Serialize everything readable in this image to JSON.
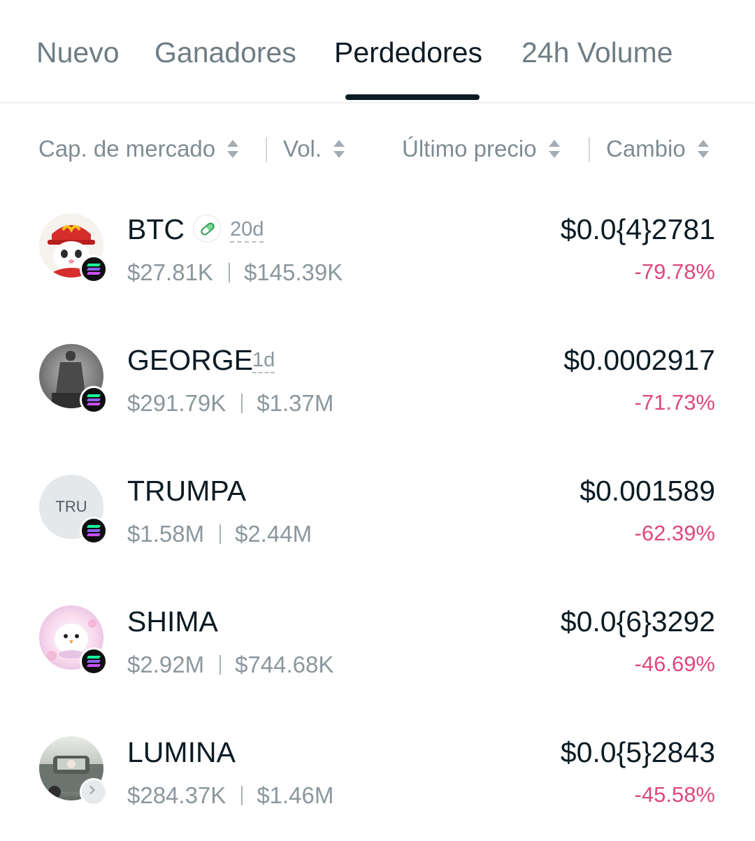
{
  "tabs": [
    {
      "label": "Nuevo",
      "active": false
    },
    {
      "label": "Ganadores",
      "active": false
    },
    {
      "label": "Perdedores",
      "active": true
    },
    {
      "label": "24h Volume",
      "active": false
    }
  ],
  "columns": {
    "market_cap": "Cap. de mercado",
    "volume": "Vol.",
    "last_price": "Último precio",
    "change": "Cambio"
  },
  "tokens": [
    {
      "symbol": "BTC",
      "age": "20d",
      "market_cap": "$27.81K",
      "volume": "$145.39K",
      "price": "$0.0{4}2781",
      "change": "-79.78%",
      "chain_icon": "solana-icon",
      "badge_icon": "pill-icon"
    },
    {
      "symbol": "GEORGE",
      "age": "1d",
      "market_cap": "$291.79K",
      "volume": "$1.37M",
      "price": "$0.0002917",
      "change": "-71.73%",
      "chain_icon": "solana-icon"
    },
    {
      "symbol": "TRUMPA",
      "avatar_text": "TRU",
      "market_cap": "$1.58M",
      "volume": "$2.44M",
      "price": "$0.001589",
      "change": "-62.39%",
      "chain_icon": "solana-icon"
    },
    {
      "symbol": "SHIMA",
      "market_cap": "$2.92M",
      "volume": "$744.68K",
      "price": "$0.0{6}3292",
      "change": "-46.69%",
      "chain_icon": "solana-icon"
    },
    {
      "symbol": "LUMINA",
      "market_cap": "$284.37K",
      "volume": "$1.46M",
      "price": "$0.0{5}2843",
      "change": "-45.58%",
      "chain_icon": "chevron-right-icon"
    }
  ],
  "colors": {
    "negative": "#e0477f",
    "text": "#0b1b24",
    "muted": "#8b979d",
    "accent_indicator": "#0b1b24"
  }
}
